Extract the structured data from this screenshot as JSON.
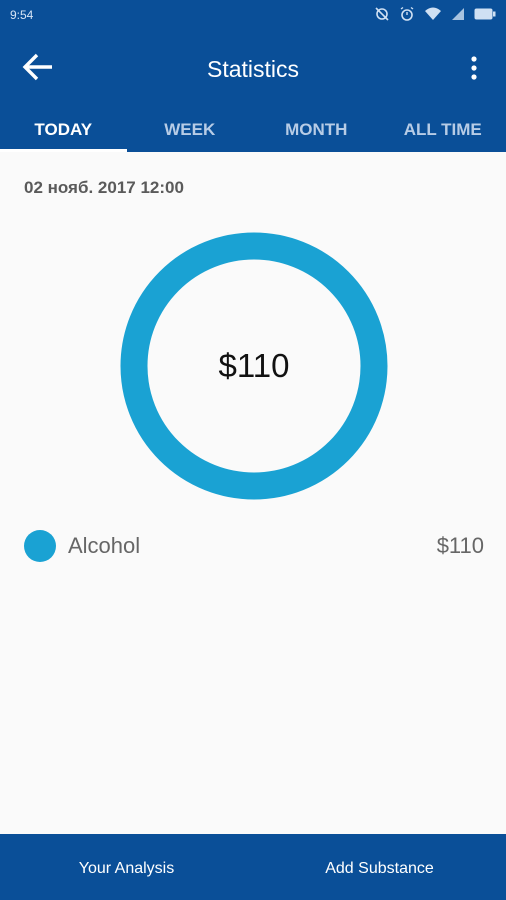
{
  "status_bar": {
    "time": "9:54",
    "icons": [
      "sync-off-icon",
      "alarm-icon",
      "wifi-icon",
      "signal-icon",
      "battery-icon"
    ]
  },
  "app_bar": {
    "title": "Statistics",
    "back_icon": "arrow-back-icon",
    "menu_icon": "more-vert-icon"
  },
  "tabs": [
    {
      "label": "TODAY",
      "active": true
    },
    {
      "label": "WEEK",
      "active": false
    },
    {
      "label": "MONTH",
      "active": false
    },
    {
      "label": "ALL TIME",
      "active": false
    }
  ],
  "content": {
    "date": "02 нояб. 2017 12:00",
    "total": "$110"
  },
  "chart_data": {
    "type": "pie",
    "categories": [
      "Alcohol"
    ],
    "values": [
      110
    ],
    "center_label": "$110",
    "colors": [
      "#1aa2d3"
    ]
  },
  "legend": [
    {
      "label": "Alcohol",
      "value": "$110",
      "color": "#1aa2d3"
    }
  ],
  "bottom_bar": {
    "analysis_label": "Your Analysis",
    "add_label": "Add Substance"
  },
  "colors": {
    "primary": "#0a4f98",
    "accent": "#1aa2d3"
  }
}
